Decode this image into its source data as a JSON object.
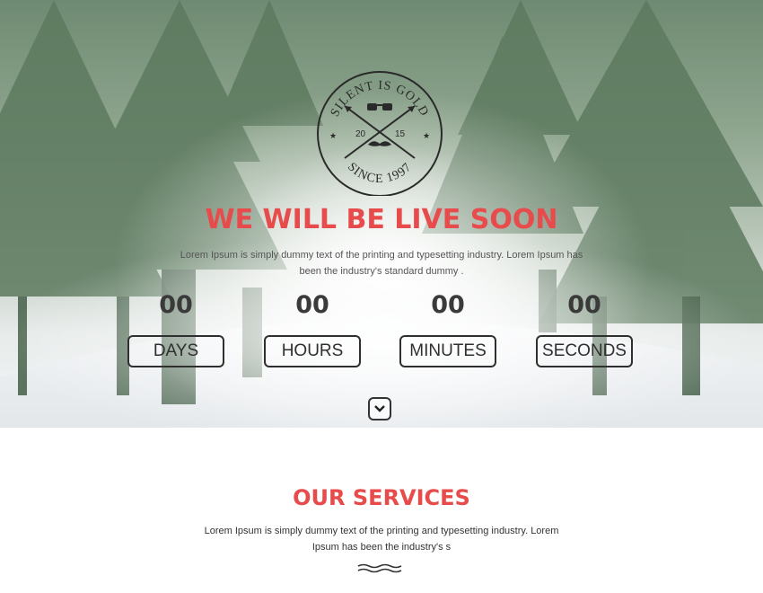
{
  "hero": {
    "emblem": {
      "top_text": "SILENT IS GOLD",
      "bottom_text": "SINCE 1997",
      "year_left": "20",
      "year_right": "15"
    },
    "title": "WE WILL BE LIVE SOON",
    "description": "Lorem Ipsum is simply dummy text of the printing and typesetting industry. Lorem Ipsum has been the industry's standard dummy ."
  },
  "countdown": [
    {
      "value": "00",
      "unit": "DAYS"
    },
    {
      "value": "00",
      "unit": "HOURS"
    },
    {
      "value": "00",
      "unit": "MINUTES"
    },
    {
      "value": "00",
      "unit": "SECONDS"
    }
  ],
  "scroll_button": {
    "icon": "chevron-down-icon"
  },
  "services": {
    "title": "OUR SERVICES",
    "description": "Lorem Ipsum is simply dummy text of the printing and typesetting industry. Lorem Ipsum has been the industry's s",
    "divider_icon": "wave-divider-icon"
  },
  "colors": {
    "accent": "#e84b4b",
    "text_dark": "#2f2f2f"
  }
}
